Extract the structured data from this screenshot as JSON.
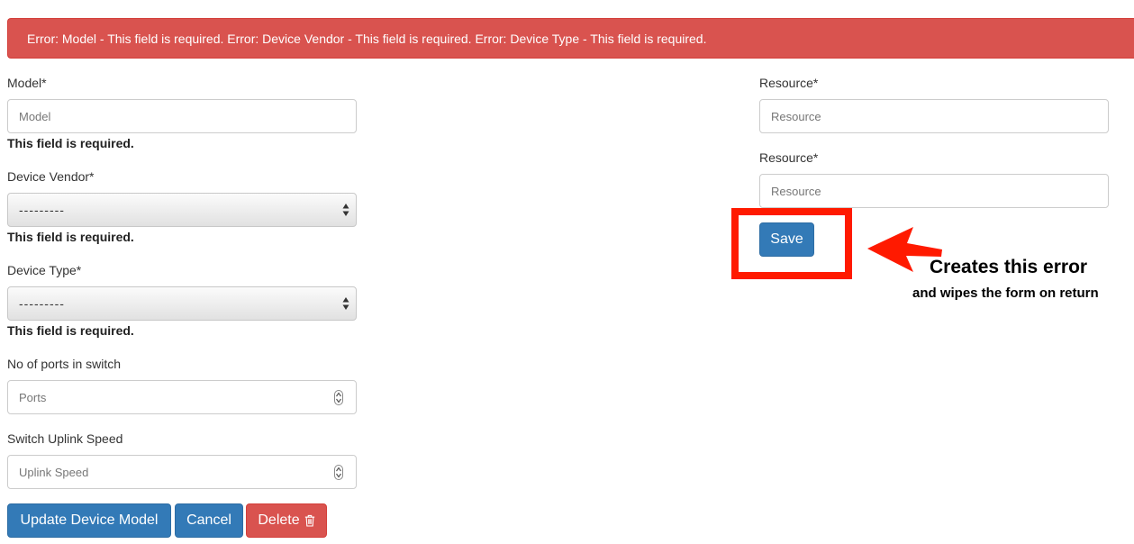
{
  "alert": {
    "message": "Error: Model - This field is required. Error: Device Vendor - This field is required. Error: Device Type - This field is required."
  },
  "form_left": {
    "model": {
      "label": "Model*",
      "placeholder": "Model",
      "error": "This field is required."
    },
    "device_vendor": {
      "label": "Device Vendor*",
      "selected": "---------",
      "error": "This field is required."
    },
    "device_type": {
      "label": "Device Type*",
      "selected": "---------",
      "error": "This field is required."
    },
    "ports": {
      "label": "No of ports in switch",
      "placeholder": "Ports"
    },
    "uplink_speed": {
      "label": "Switch Uplink Speed",
      "placeholder": "Uplink Speed"
    }
  },
  "form_right": {
    "resource_1": {
      "label": "Resource*",
      "placeholder": "Resource"
    },
    "resource_2": {
      "label": "Resource*",
      "placeholder": "Resource"
    },
    "save_label": "Save"
  },
  "actions": {
    "update_label": "Update Device Model",
    "cancel_label": "Cancel",
    "delete_label": "Delete"
  },
  "annotation": {
    "title": "Creates this error",
    "subtitle": "and wipes the form on return"
  },
  "colors": {
    "alert_bg": "#d9534f",
    "primary": "#337ab7",
    "danger": "#d9534f",
    "annotation_red": "#ff1a00"
  },
  "icons": {
    "delete": "trash-icon",
    "select": "select-arrows-icon",
    "number": "number-spinner-icon",
    "annotation": "arrow-left-icon"
  }
}
